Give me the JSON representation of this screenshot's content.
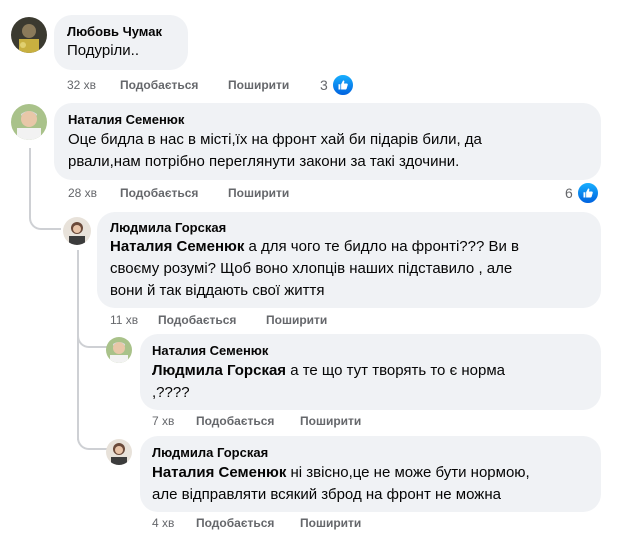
{
  "actions": {
    "like": "Подобається",
    "share": "Поширити"
  },
  "comments": [
    {
      "author": "Любовь Чумак",
      "text": "Подуріли..",
      "time": "32 хв",
      "reactions": "3"
    },
    {
      "author": "Наталия Семенюк",
      "text_line1": "Оце бидла в нас в місті,їх на фронт хай би підарів били, да",
      "text_line2": "рвали,нам потрібно переглянути закони за такі здочини.",
      "time": "28 хв",
      "reactions": "6"
    },
    {
      "author": "Людмила Горская",
      "mention": "Наталия Семенюк",
      "text_line1": " а для чого те бидло на фронті??? Ви в",
      "text_line2": "своєму розумі? Щоб воно хлопців наших підставило , але",
      "text_line3": "вони й так віддають свої життя",
      "time": "11 хв"
    },
    {
      "author": "Наталия Семенюк",
      "mention": "Людмила Горская",
      "text_line1": " а те що тут творять то є норма",
      "text_line2": ",????",
      "time": "7 хв"
    },
    {
      "author": "Людмила Горская",
      "mention": "Наталия Семенюк",
      "text_line1": " ні звісно,це не може бути нормою,",
      "text_line2": "але відправляти всякий зброд на фронт не можна",
      "time": "4 хв"
    }
  ],
  "colors": {
    "bubble": "#f0f2f5",
    "meta_text": "#65676b",
    "like_blue": "#1877f2",
    "thread_line": "#ced0d4"
  },
  "icons": [
    "avatar",
    "like-icon"
  ]
}
